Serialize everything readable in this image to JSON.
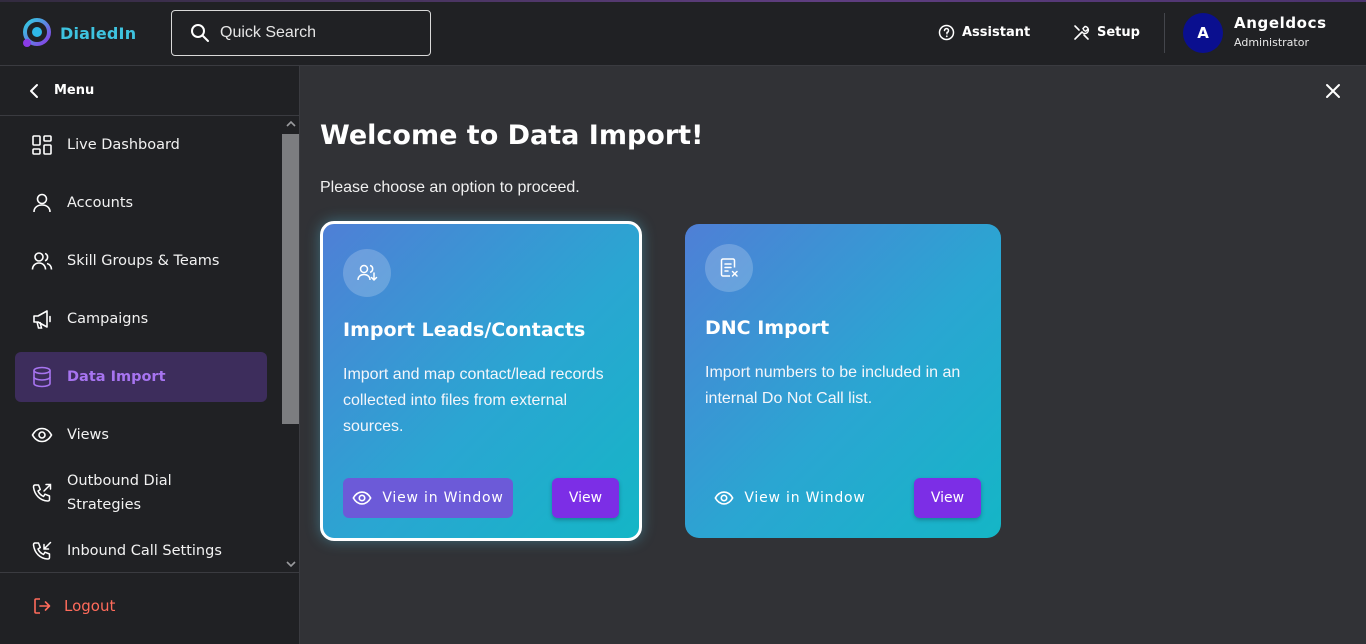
{
  "app": {
    "logo_text": "DialedIn",
    "search_placeholder": "Quick Search"
  },
  "header": {
    "assistant_label": "Assistant",
    "setup_label": "Setup",
    "user": {
      "initial": "A",
      "name": "Angeldocs",
      "role": "Administrator",
      "avatar_color": "#0a0f8f"
    }
  },
  "sidebar": {
    "menu_label": "Menu",
    "items": [
      {
        "label": "Live Dashboard",
        "icon": "dashboard-grid-icon"
      },
      {
        "label": "Accounts",
        "icon": "user-icon"
      },
      {
        "label": "Skill Groups & Teams",
        "icon": "users-icon"
      },
      {
        "label": "Campaigns",
        "icon": "megaphone-icon"
      },
      {
        "label": "Data Import",
        "icon": "database-icon",
        "active": true
      },
      {
        "label": "Views",
        "icon": "eye-icon"
      },
      {
        "label_line1": "Outbound Dial",
        "label_line2": "Strategies",
        "icon": "phone-outgoing-icon"
      },
      {
        "label": "Inbound Call Settings",
        "icon": "phone-incoming-icon"
      }
    ],
    "logout_label": "Logout"
  },
  "main": {
    "title": "Welcome to Data Import!",
    "subtitle": "Please choose an option to proceed.",
    "cards": [
      {
        "title": "Import Leads/Contacts",
        "description": "Import and map contact/lead records collected into files from external sources.",
        "view_window_label": "View in Window",
        "view_label": "View",
        "selected": true
      },
      {
        "title": "DNC Import",
        "description": "Import numbers to be included in an internal Do Not Call list.",
        "view_window_label": "View in Window",
        "view_label": "View",
        "selected": false
      }
    ]
  },
  "colors": {
    "accent_purple": "#7c2ee6",
    "active_nav_bg": "#3d2d5c",
    "active_nav_text": "#a774f0",
    "logout_red": "#ff6b5b",
    "logo_cyan": "#3ec3df"
  }
}
